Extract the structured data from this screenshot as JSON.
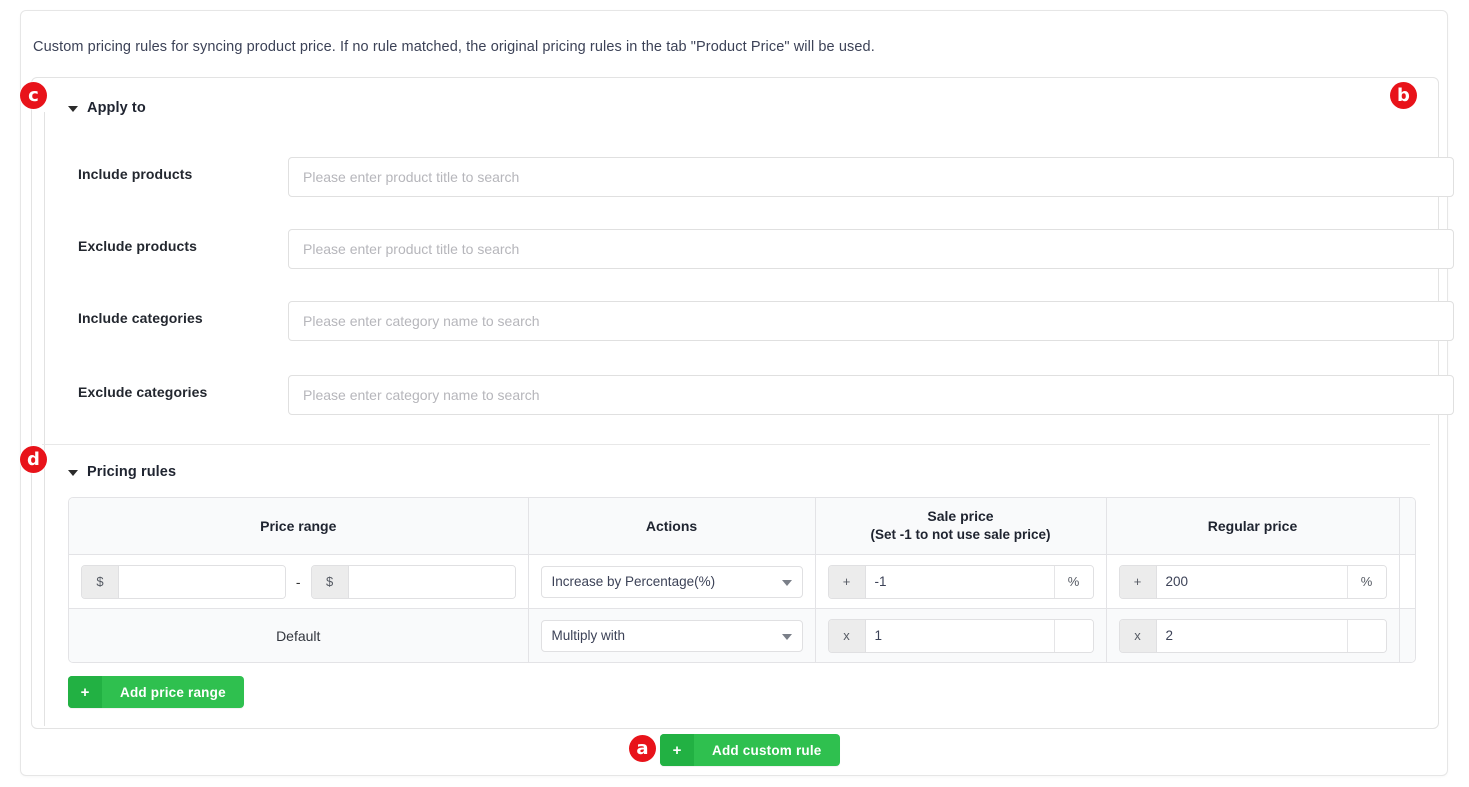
{
  "intro": {
    "text": "Custom pricing rules for syncing product price. If no rule matched, the original pricing rules in the tab \"Product Price\" will be used."
  },
  "annotations": [
    {
      "id": "a",
      "label": "a",
      "target": "add-custom-rule-button"
    },
    {
      "id": "b",
      "label": "b",
      "target": "delete-rule-icon"
    },
    {
      "id": "c",
      "label": "c",
      "target": "apply-to-section"
    },
    {
      "id": "d",
      "label": "d",
      "target": "pricing-rules-section"
    }
  ],
  "apply_to": {
    "title": "Apply to",
    "caret": "caret-down-icon",
    "delete_icon": "trash-icon",
    "fields": [
      {
        "label": "Include products",
        "value": "",
        "placeholder": "Please enter product title to search"
      },
      {
        "label": "Exclude products",
        "value": "",
        "placeholder": "Please enter product title to search"
      },
      {
        "label": "Include categories",
        "value": "",
        "placeholder": "Please enter category name to search"
      },
      {
        "label": "Exclude categories",
        "value": "",
        "placeholder": "Please enter category name to search"
      }
    ]
  },
  "pricing_rules": {
    "title": "Pricing rules",
    "caret": "caret-down-icon",
    "columns": {
      "price_range": "Price range",
      "actions": "Actions",
      "sale_price": "Sale price",
      "sale_price_sub": "(Set -1 to not use sale price)",
      "regular_price": "Regular price",
      "blank": ""
    },
    "rows": [
      {
        "type": "range",
        "range_min": {
          "prefix": "$",
          "value": "",
          "placeholder": ""
        },
        "range_sep": "-",
        "range_max": {
          "prefix": "$",
          "value": "",
          "placeholder": ""
        },
        "action": "Increase by Percentage(%)",
        "sale_price": {
          "prefix": "+",
          "value": "-1",
          "suffix": "%"
        },
        "regular_price": {
          "prefix": "+",
          "value": "200",
          "suffix": "%"
        }
      },
      {
        "type": "default",
        "label": "Default",
        "action": "Multiply with",
        "sale_price": {
          "prefix": "x",
          "value": "1",
          "suffix": ""
        },
        "regular_price": {
          "prefix": "x",
          "value": "2",
          "suffix": ""
        }
      }
    ],
    "add_price_range": {
      "icon": "plus-icon",
      "icon_glyph": "+",
      "label": "Add price range"
    }
  },
  "footer": {
    "add_custom_rule": {
      "icon": "plus-icon",
      "icon_glyph": "+",
      "label": "Add custom rule"
    }
  },
  "colors": {
    "green": "#2fc04f",
    "green_dark": "#22b143",
    "badge_red": "#e8131a",
    "trash_red": "#e8131a",
    "border": "#e3e3e6",
    "header_bg": "#f9fafb",
    "text": "#1f2430",
    "placeholder": "#b6b6bb"
  }
}
